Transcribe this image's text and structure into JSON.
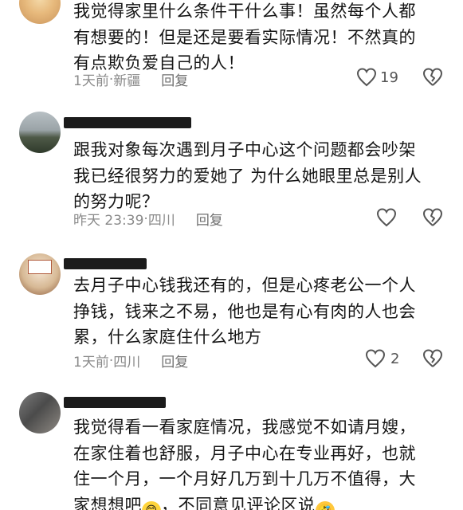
{
  "comments": [
    {
      "text": "我觉得家里什么条件干什么事！虽然每个人都\n有想要的！但是还是要看实际情况！不然真的\n有点欺负爱自己的人！",
      "time": "1天前",
      "location": "新疆",
      "reply": "回复",
      "likes": "19"
    },
    {
      "text": "跟我对象每次遇到月子中心这个问题都会吵架\n我已经很努力的爱她了 为什么她眼里总是别人\n的努力呢？",
      "time": "昨天 23:39",
      "location": "四川",
      "reply": "回复",
      "likes": ""
    },
    {
      "text": "去月子中心钱我还有的，但是心疼老公一个人\n挣钱，钱来之不易，他也是有心有肉的人也会\n累，什么家庭住什么地方",
      "time": "1天前",
      "location": "四川",
      "reply": "回复",
      "likes": "2"
    },
    {
      "text_line1": "我觉得看一看家庭情况，我感觉不如请月嫂，",
      "text_line2": "在家住着也舒服，月子中心在专业再好，也就",
      "text_line3": "住一个月，一个月好几万到十几万不值得，大",
      "text_line4a": "家想想吧",
      "text_line4b": "，不同意见评论区说",
      "emoji1": "😁",
      "emoji2": "🤣"
    }
  ],
  "separator": " · ",
  "colors": {
    "icon": "#555555",
    "meta": "#8a8a8a"
  }
}
